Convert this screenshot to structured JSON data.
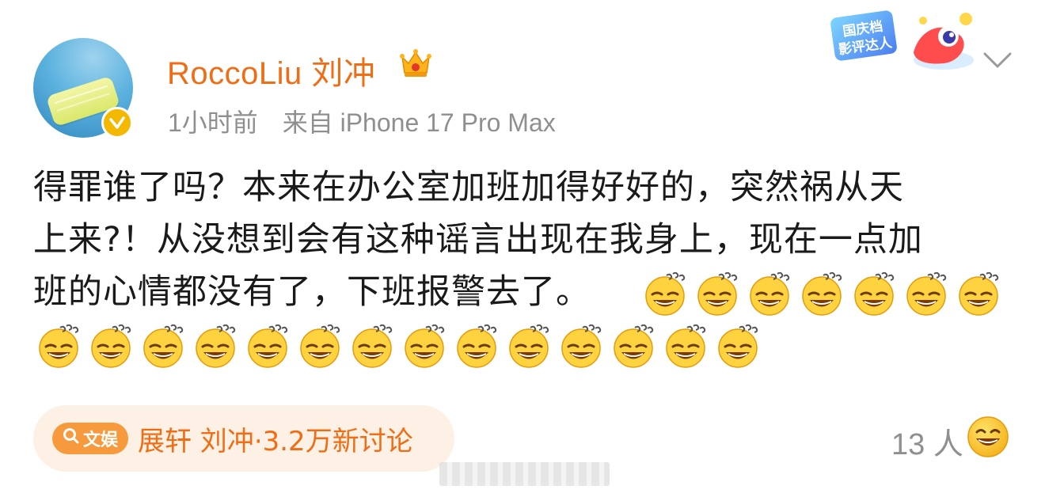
{
  "post": {
    "author": {
      "name": "RoccoLiu 刘冲",
      "verified": true
    },
    "meta": {
      "time": "1小时前",
      "source": "来自 iPhone 17 Pro Max"
    },
    "event_badge": {
      "text_line1": "国庆档",
      "text_line2": "影评达人"
    },
    "content": {
      "line1": "得罪谁了吗？本来在办公室加班加得好好的，突然祸从天",
      "line2": "上来?！从没想到会有这种谣言出现在我身上，现在一点加",
      "line3": "班的心情都没有了，下班报警去了。",
      "emoji_name": "dizzy-grin-emoji",
      "emoji_count_line3": 7,
      "emoji_count_line4": 14
    },
    "topic": {
      "tag": "文娱",
      "tag_icon": "search-icon",
      "title": "展轩 刘冲",
      "count": "·3.2万新讨论"
    },
    "reactions": {
      "count": "13 人",
      "emoji_name": "grin-emoji"
    }
  },
  "colors": {
    "accent": "#ef6d15",
    "meta_gray": "#8f8f8f",
    "topic_bg": "#fdf0e4",
    "tag_bg": "#f79a3d",
    "verified": "#f5b800"
  }
}
